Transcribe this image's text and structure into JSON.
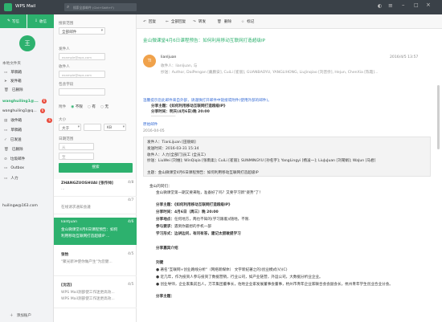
{
  "app": {
    "title": "WPS Mail",
    "search_placeholder": "搜索全部邮件 (Ctrl+Shift+F)",
    "accent": "#2db16e",
    "titlebar_bg": "#3a4148"
  },
  "sidebar": {
    "compose": "写信",
    "receive": "收信",
    "local_folders": "本地文件夹",
    "items_top": [
      {
        "label": "草稿箱"
      },
      {
        "label": "发件箱"
      },
      {
        "label": "已删除"
      }
    ],
    "account1": {
      "label": "wanghuiling1@...",
      "badge": "6"
    },
    "account2": {
      "label": "wanghuiling1@q...",
      "badge": "6"
    },
    "folders": [
      {
        "label": "收件箱",
        "badge": "6"
      },
      {
        "label": "草稿箱"
      },
      {
        "label": "已发送"
      },
      {
        "label": "已删除"
      },
      {
        "label": "垃圾邮件"
      },
      {
        "label": "Outbox"
      },
      {
        "label": "人力"
      }
    ],
    "account3": {
      "label": "huilingw@163.com",
      "badge": ""
    },
    "add_account": "添加账户"
  },
  "filter": {
    "search_scope_label": "搜索范围",
    "search_scope_value": "全部邮件",
    "sender_label": "发件人",
    "sender_placeholder": "example@wps.com",
    "recipient_label": "收件人",
    "recipient_placeholder": "example@wps.com",
    "subject_label": "包含字段",
    "attachment_label": "附件",
    "att_options": [
      "不限",
      "有",
      "无"
    ],
    "size_label": "大小",
    "size_op": "大于",
    "size_unit": "KB",
    "date_label": "日期范围",
    "date_from": "从",
    "date_to": "至",
    "search_button": "搜索"
  },
  "messages": [
    {
      "sender": "ZHANGZUOSHUAI [张作帅]",
      "date": "4/8",
      "preview1": "...",
      "preview2": "",
      "selected": false
    },
    {
      "sender": "",
      "date": "4/7",
      "preview1": "在线请求通知会議",
      "preview2": "...",
      "selected": false
    },
    {
      "sender": "liantjuan",
      "date": "4/6",
      "preview1": "金山微课堂4月6日课程预告：如何",
      "preview2": "利用移动互联网打造超级IP ...",
      "selected": true
    },
    {
      "sender": "张怡",
      "date": "4/5",
      "preview1": "\"聚光新冲使你做产生\"为您健...",
      "preview2": "",
      "selected": false
    },
    {
      "sender": "[沈洁]",
      "date": "4/5",
      "preview1": "WPS Mail测部使工作迷更高效...",
      "preview2": "WPS Mail测部使工作迷更高效...",
      "selected": false
    }
  ],
  "toolbar": {
    "reply": "回复",
    "reply_all": "全部回复",
    "forward": "转发",
    "delete": "删除",
    "mark": "标记"
  },
  "mail": {
    "subject": "金山微课堂4月6日课程预告：如何利用移动互联网打造超级IP",
    "avatar": "TI",
    "from": "lianljuan",
    "date": "2016/4/5 13:57",
    "to_line": "收件人：lianljuan, 与",
    "cc_line": "抄送：Author, DaiPengan [戴鹏安], CuiLi [崔丽], GUANBAOYU, YANGLIHONG, LiuJinqiao [刘晋侨], Hejun, ChenXia [陈霞]...",
    "notice_line1": "温馨提示您此邮件来自外部，请谨慎打开邮件中链接或附件(使用外部的邮件)。",
    "notice_title_label": "分享主题：",
    "notice_title": "《如何利用移动互联网打造超级IP》",
    "notice_time_label": "分享时间：",
    "notice_time": "明天(4月6日)晚 20:00",
    "separator": "───────────",
    "orig_label": "原始邮件",
    "orig_date": "2016-04-05",
    "orig_meta": [
      "发件人：TianLijuan [田丽娟]",
      "发送时间：2016-03-31 15:34",
      "收件人：人力[全部门]员工 (全员工)",
      "抄送：LiuWei [刘维]; WinQiqia [张雨柔]; CuiLi [崔丽]; SUNMINGYU [孙名宇]; YangLingyi [杨凌一]; LiuJuJuan [刘菊娟]; WaJun [马君]",
      "主题：金山微课堂4月6日课程预告：如何利用移动互联网打造超级IP"
    ],
    "greeting": "金山的同们：",
    "intro": "金山微课堂第一期又要来啦，准备好了吗？又要学习新\"姿势\"了！",
    "share_theme_label": "分享主题：",
    "share_theme": "《如何利用移动互联网打造超级IP》",
    "share_time_label": "分享时间：",
    "share_time": "4月6日（周三）晚 20:00",
    "share_place_label": "分享地点：",
    "share_place": "任何地方，两也不知的(学习跟着)/随地，不限.",
    "join_label": "参与要求：",
    "join": "遇到你最想的手机一部",
    "study_label": "学习形式：",
    "study": "边讲边问，有问有答，建记太胆敢提学习",
    "guest_title": "分享嘉宾介绍",
    "guest_name": "刘健",
    "bullets": [
      "● 著名\"互联网+创业路线分析\"（网络新媒体）  文字新纪著之的)创业模式(V)(C)",
      "● 近几年，作为投资人参与投资了数据营销，行业公司，如产业链营，外运公司，大数据分析业企业。",
      "● 创业导师，企业家集前出人，万丰集团董事长，佐地企业家发展董事会董事，杭州市青年企业家联合会会副会长，杭州青年学生创业合业分会。"
    ],
    "share_theme2_label": "分享主题："
  }
}
